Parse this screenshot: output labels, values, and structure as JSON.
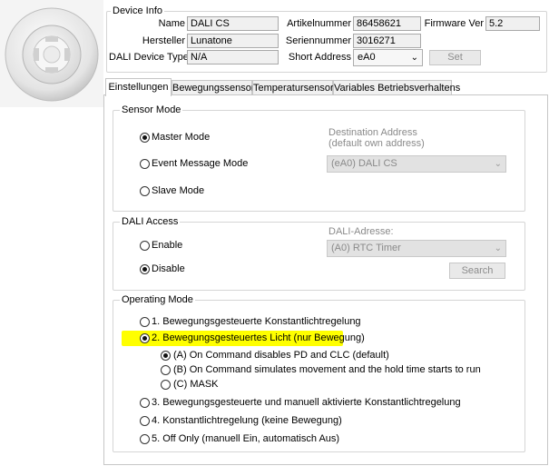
{
  "device_info": {
    "title": "Device Info",
    "name_label": "Name",
    "name_value": "DALI CS",
    "hersteller_label": "Hersteller",
    "hersteller_value": "Lunatone",
    "device_type_label": "DALI Device Type",
    "device_type_value": "N/A",
    "artikelnummer_label": "Artikelnummer",
    "artikelnummer_value": "86458621",
    "seriennummer_label": "Seriennummer",
    "seriennummer_value": "3016271",
    "short_address_label": "Short Address",
    "short_address_value": "eA0",
    "firmware_label": "Firmware Ver",
    "firmware_value": "5.2",
    "set_button": "Set"
  },
  "tabs": [
    {
      "label": "Einstellungen",
      "active": true
    },
    {
      "label": "Bewegungssensor",
      "active": false
    },
    {
      "label": "Temperatursensor",
      "active": false
    },
    {
      "label": "Variables Betriebsverhaltens",
      "active": false
    }
  ],
  "sensor_mode": {
    "title": "Sensor Mode",
    "options": [
      {
        "label": "Master Mode",
        "checked": true
      },
      {
        "label": "Event Message Mode",
        "checked": false
      },
      {
        "label": "Slave Mode",
        "checked": false
      }
    ],
    "destination_label_1": "Destination Address",
    "destination_label_2": "(default own address)",
    "destination_value": "(eA0) DALI CS"
  },
  "dali_access": {
    "title": "DALI Access",
    "options": [
      {
        "label": "Enable",
        "checked": false
      },
      {
        "label": "Disable",
        "checked": true
      }
    ],
    "address_label": "DALI-Adresse:",
    "address_value": "(A0) RTC Timer",
    "search_button": "Search"
  },
  "operating_mode": {
    "title": "Operating Mode",
    "options": [
      {
        "label": "1. Bewegungsgesteuerte Konstantlichtregelung",
        "checked": false
      },
      {
        "label": "2. Bewegungsgesteuertes Licht (nur Bewegung)",
        "checked": true,
        "highlighted": true
      },
      {
        "label": "3. Bewegungsgesteuerte und manuell aktivierte Konstantlichtregelung",
        "checked": false
      },
      {
        "label": "4. Konstantlichtregelung (keine Bewegung)",
        "checked": false
      },
      {
        "label": "5. Off Only (manuell Ein, automatisch Aus)",
        "checked": false
      }
    ],
    "sub_options": [
      {
        "label": "(A) On Command disables PD and CLC (default)",
        "checked": true
      },
      {
        "label": "(B) On Command simulates movement and the hold time starts to run",
        "checked": false
      },
      {
        "label": "(C) MASK",
        "checked": false
      }
    ],
    "highlight_color": "#ffff00"
  },
  "icons": {
    "dropdown": "chevron-down-icon",
    "device": "motion-sensor-icon"
  }
}
